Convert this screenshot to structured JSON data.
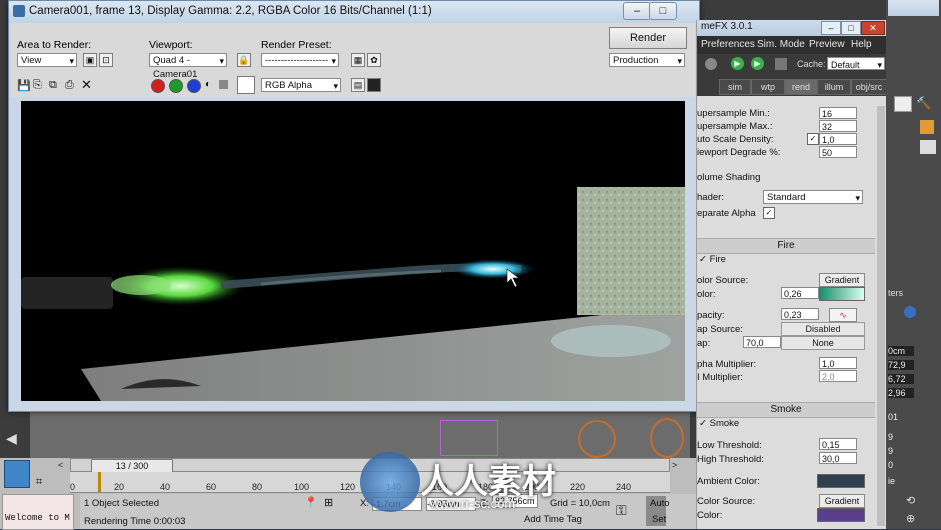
{
  "render_window": {
    "title": "Camera001, frame 13, Display Gamma: 2.2, RGBA Color 16 Bits/Channel (1:1)",
    "area_to_render_label": "Area to Render:",
    "area_to_render_value": "View",
    "viewport_label": "Viewport:",
    "viewport_value": "Quad 4 - Camera01",
    "render_preset_label": "Render Preset:",
    "render_preset_value": "--------------------",
    "render_button": "Render",
    "production_value": "Production",
    "channel_value": "RGB Alpha"
  },
  "fumefx": {
    "title": "meFX 3.0.1",
    "menu": [
      "Preferences",
      "Sim. Mode",
      "Preview",
      "Help"
    ],
    "cache_label": "Cache:",
    "cache_value": "Default",
    "tabs": [
      "sim",
      "wtp",
      "rend",
      "illum",
      "obj/src"
    ],
    "params": [
      {
        "label": "upersample Min.:",
        "value": "16"
      },
      {
        "label": "upersample Max.:",
        "value": "32"
      },
      {
        "label": "uto Scale Density:",
        "value": "1,0"
      },
      {
        "label": "iewport Degrade %:",
        "value": "50"
      }
    ],
    "volume_shading": "olume Shading",
    "shader_label": "hader:",
    "shader_value": "Standard",
    "separate_alpha": "eparate Alpha",
    "fire_section": "Fire",
    "fire_check": "Fire",
    "color_source_label": "olor Source:",
    "color_source_value": "Gradient",
    "color_label": "olor:",
    "color_value": "0,26",
    "opacity_label": "pacity:",
    "opacity_value": "0,23",
    "map_source_label": "ap Source:",
    "map_source_value": "Disabled",
    "map_label": "ap:",
    "map_value": "70,0",
    "map_none": "None",
    "alpha_mult_label": "pha Multiplier:",
    "alpha_mult_value": "1,0",
    "i_mult_label": "I Multiplier:",
    "i_mult_value": "2,0",
    "smoke_section": "Smoke",
    "smoke_check": "Smoke",
    "low_threshold_label": "Low Threshold:",
    "low_threshold_value": "0,15",
    "high_threshold_label": "High Threshold:",
    "high_threshold_value": "30,0",
    "ambient_color_label": "Ambient Color:",
    "smoke_color_source_label": "Color Source:",
    "smoke_color_source_value": "Gradient",
    "smoke_color_label": "Color:",
    "colors": {
      "fire_grad_start": "#1a8f6a",
      "fire_grad_end": "#d8fff0",
      "ambient": "#2f3f4f",
      "smoke_color": "#5a3f8a"
    }
  },
  "far_right": {
    "labels": [
      "ters",
      "0cm",
      "72,9",
      "6,72",
      "2,96",
      "01",
      "9",
      "9",
      "0",
      "ie"
    ]
  },
  "timeline": {
    "frame_display": "13 / 300",
    "ticks": [
      "0",
      "20",
      "40",
      "60",
      "80",
      "100",
      "120",
      "140",
      "160",
      "180",
      "200",
      "220",
      "240"
    ]
  },
  "status": {
    "welcome": "Welcome to M",
    "selected": "1 Object Selected",
    "render_time": "Rendering Time 0:00:03",
    "x_label": "X:",
    "x_value": "-1,7cm",
    "y_value": "-3,85cm",
    "z_label": "Z:",
    "z_value": "82,756cm",
    "grid": "Grid = 10,0cm",
    "add_time_tag": "Add Time Tag",
    "auto": "Auto",
    "set": "Set"
  },
  "watermark": {
    "main": "人人素材",
    "sub": "www.rr-sc.com"
  }
}
